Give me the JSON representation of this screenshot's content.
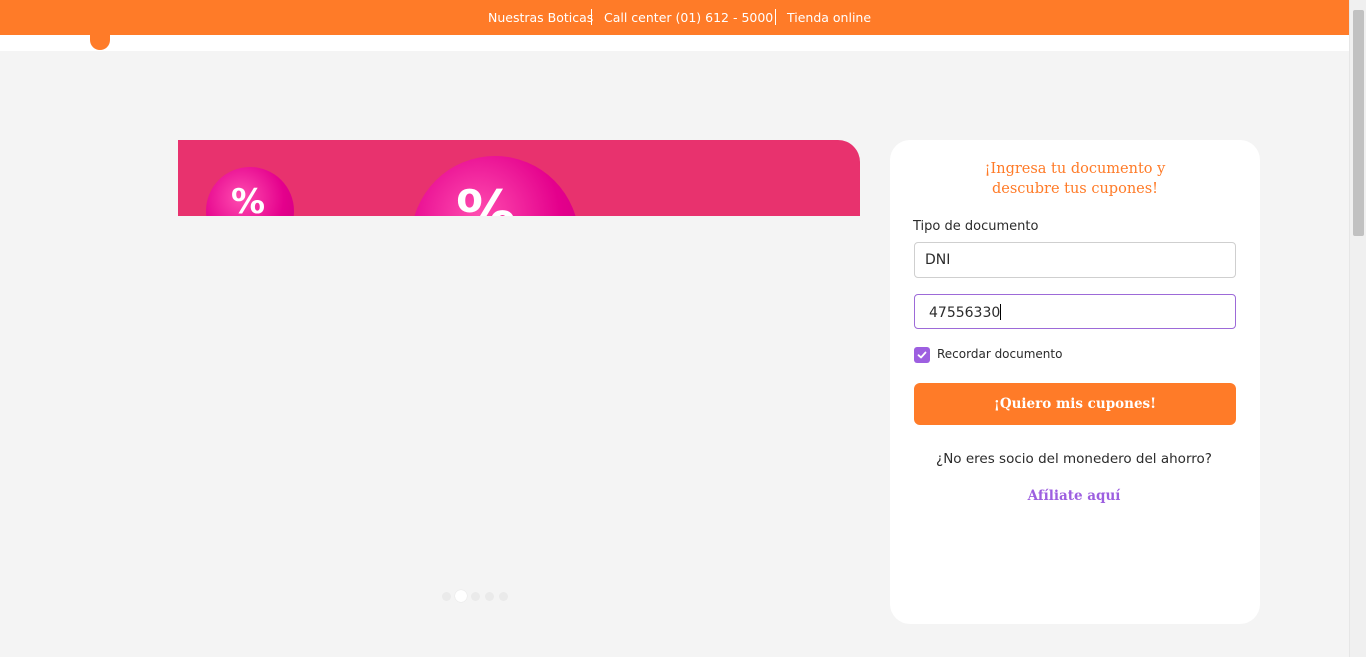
{
  "topbar": {
    "links": [
      "Nuestras Boticas",
      "Call center (01) 612 - 5000",
      "Tienda online"
    ],
    "color": "#ff7b28"
  },
  "banner": {
    "percent_glyph": "%",
    "color": "#e8326e"
  },
  "carousel": {
    "count": 5,
    "active_index": 1
  },
  "form": {
    "title_line1": "¡Ingresa tu documento y",
    "title_line2": "descubre tus cupones!",
    "doc_type_label": "Tipo de documento",
    "doc_type_value": "DNI",
    "doc_number_value": "47556330",
    "remember_label": "Recordar documento",
    "remember_checked": true,
    "submit_label": "¡Quiero mis cupones!",
    "not_member_text": "¿No eres socio del monedero del ahorro?",
    "affiliate_link": "Afíliate aquí",
    "accent_color": "#9d5fe0"
  },
  "icons": {
    "checkbox": "check-icon",
    "logo": "logo-shape"
  }
}
